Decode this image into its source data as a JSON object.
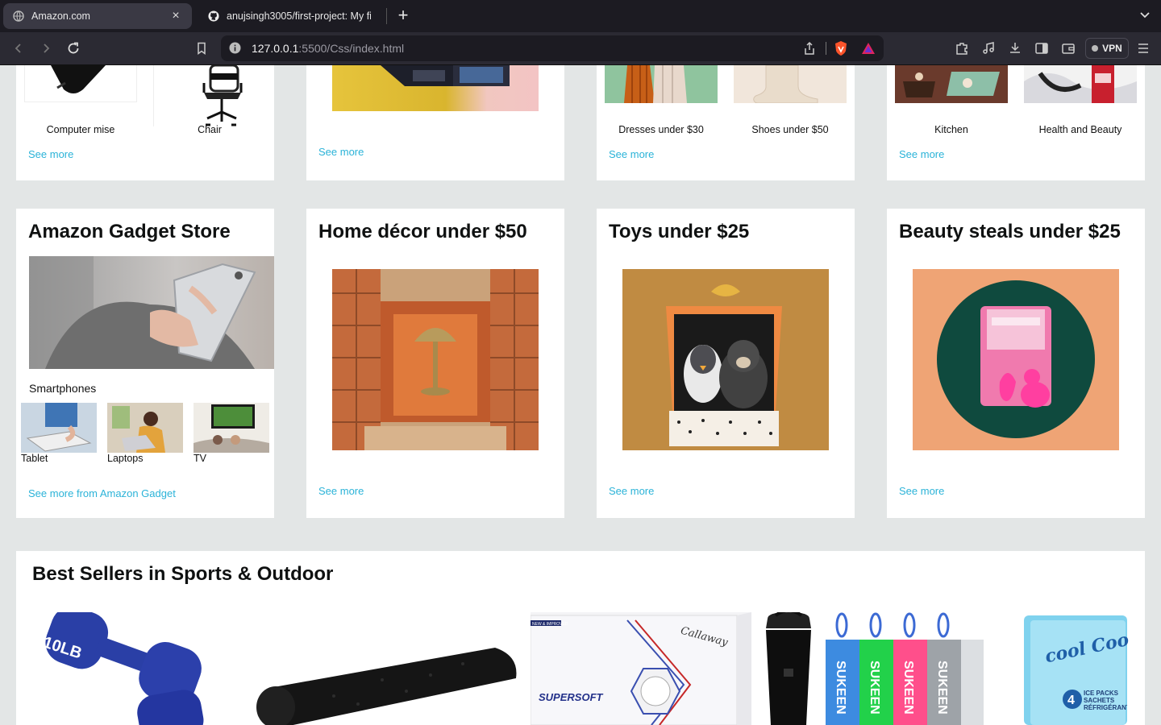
{
  "browser": {
    "tabs": [
      {
        "title": "Amazon.com",
        "active": true
      },
      {
        "title": "anujsingh3005/first-project: My fi",
        "active": false
      }
    ],
    "url": {
      "host": "127.0.0.1",
      "path": ":5500/Css/index.html"
    },
    "vpn_label": "VPN"
  },
  "top_row": [
    {
      "items": [
        "Computer mise",
        "Chair"
      ],
      "see_more": "See more"
    },
    {
      "items": [],
      "see_more": "See more"
    },
    {
      "items": [
        "Dresses under $30",
        "Shoes under $50"
      ],
      "see_more": "See more"
    },
    {
      "items": [
        "Kitchen",
        "Health and Beauty"
      ],
      "see_more": "See more"
    }
  ],
  "gadget_card": {
    "title": "Amazon Gadget Store",
    "main_caption": "Smartphones",
    "thumbs": [
      "Tablet",
      "Laptops",
      "TV"
    ],
    "link": "See more from Amazon Gadget"
  },
  "cards": [
    {
      "title": "Home décor under $50",
      "see_more": "See more"
    },
    {
      "title": "Toys under $25",
      "see_more": "See more"
    },
    {
      "title": "Beauty steals under $25",
      "see_more": "See more"
    }
  ],
  "best_sellers": {
    "title": "Best Sellers in Sports & Outdoor",
    "products": [
      {
        "label": "10LB"
      },
      {
        "label": ""
      },
      {
        "label": "SUPERSOFT",
        "brand": "Callaway",
        "tag": "NEW & IMPROVED"
      },
      {
        "label": ""
      },
      {
        "label": "SUKEEN"
      },
      {
        "label": "Cooler",
        "brand": "cool Coolers",
        "pack_count": "4",
        "pack_text": "ICE PACKS SACHETS RÉFRIGÉRANTS"
      }
    ]
  },
  "colors": {
    "link": "#2bb3d8",
    "page_bg": "#e3e6e6",
    "chrome_bg": "#2b2a33"
  }
}
